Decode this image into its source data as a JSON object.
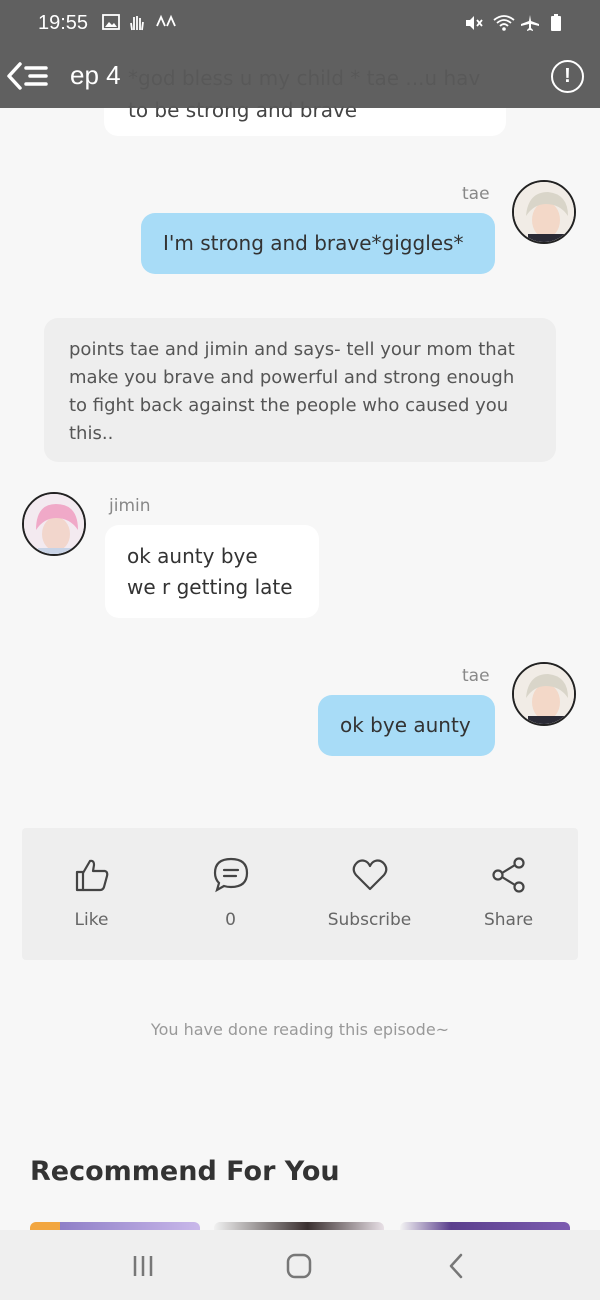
{
  "status_bar": {
    "time": "19:55"
  },
  "header": {
    "episode_title": "ep 4"
  },
  "messages": {
    "partial": {
      "text": "*god bless u my child * tae ...u hav to be strong and brave"
    },
    "tae1": {
      "name": "tae",
      "text": "I'm strong and brave*giggles*"
    },
    "narration": {
      "text": "points tae and jimin and says- tell your mom that make you brave and powerful and strong enough to fight back against the people who caused you this.."
    },
    "jimin1": {
      "name": "jimin",
      "line1": "ok aunty bye",
      "line2": "we r getting late"
    },
    "tae2": {
      "name": "tae",
      "text": "ok bye aunty"
    }
  },
  "actions": {
    "like": "Like",
    "comments_count": "0",
    "subscribe": "Subscribe",
    "share": "Share"
  },
  "end_text": "You have done reading this episode~",
  "recommend": {
    "title": "Recommend For You"
  }
}
